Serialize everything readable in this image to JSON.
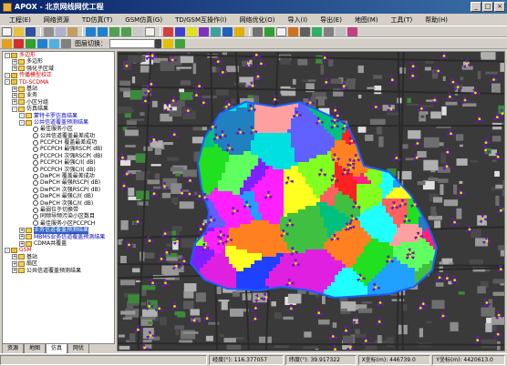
{
  "window": {
    "title": "APOX - 北京网线网优工程",
    "min": "_",
    "max": "□",
    "close": "×"
  },
  "menu": [
    "工程(E)",
    "网络资源",
    "TD仿真(T)",
    "GSM仿真(G)",
    "TD/GSM互操作(I)",
    "网络优化(O)",
    "导入(I)",
    "导出(E)",
    "地图(M)",
    "工具(T)",
    "帮助(H)"
  ],
  "toolbar2": {
    "label": "图层切换："
  },
  "tree": [
    {
      "level": 0,
      "exp": "-",
      "icon": "folder",
      "text": "多边形",
      "color": "red"
    },
    {
      "level": 1,
      "exp": "+",
      "icon": "item",
      "text": "多边形"
    },
    {
      "level": 1,
      "exp": "+",
      "icon": "item",
      "text": "强化子区域"
    },
    {
      "level": 0,
      "exp": "-",
      "icon": "folder",
      "text": "传播模型校正",
      "color": "red"
    },
    {
      "level": 0,
      "exp": "-",
      "icon": "folder",
      "text": "TD-SCDMA",
      "color": "red"
    },
    {
      "level": 1,
      "exp": "+",
      "icon": "item",
      "text": "基站"
    },
    {
      "level": 1,
      "exp": "+",
      "icon": "item",
      "text": "业务"
    },
    {
      "level": 1,
      "exp": "+",
      "icon": "item",
      "text": "小区分组"
    },
    {
      "level": 1,
      "exp": "-",
      "icon": "item",
      "text": "仿真结果"
    },
    {
      "level": 2,
      "exp": "-",
      "icon": "item",
      "text": "蒙特卡罗仿真结果",
      "color": "blue"
    },
    {
      "level": 2,
      "exp": "-",
      "icon": "item",
      "text": "公共信道覆盖预测结果",
      "color": "blue"
    },
    {
      "level": 3,
      "exp": "",
      "icon": "radio",
      "text": "最佳服务小区"
    },
    {
      "level": 3,
      "exp": "",
      "icon": "radio",
      "text": "公共信道覆盖最差成功"
    },
    {
      "level": 3,
      "exp": "",
      "icon": "radio",
      "text": "PCCPCH 覆盖最差成功"
    },
    {
      "level": 3,
      "exp": "",
      "icon": "radio",
      "text": "PCCPCH 最强RSCP( dB)"
    },
    {
      "level": 3,
      "exp": "",
      "icon": "radio",
      "text": "PCCPCH 次强RSCP( dB)"
    },
    {
      "level": 3,
      "exp": "",
      "icon": "radio",
      "text": "PCCPCH 最强C/I( dB)"
    },
    {
      "level": 3,
      "exp": "",
      "icon": "radio",
      "text": "PCCPCH 次强C/I( dB)"
    },
    {
      "level": 3,
      "exp": "",
      "icon": "radio",
      "text": "DwPCH 覆盖最差成功"
    },
    {
      "level": 3,
      "exp": "",
      "icon": "radio",
      "text": "DwPCH 最强RSCP( dB)"
    },
    {
      "level": 3,
      "exp": "",
      "icon": "radio",
      "text": "DwPCH 次强RSCP( dB)"
    },
    {
      "level": 3,
      "exp": "",
      "icon": "radio",
      "text": "DwPCH 最强C/I( dB)"
    },
    {
      "level": 3,
      "exp": "",
      "icon": "radio",
      "text": "DwPCH 次强C/I( dB)"
    },
    {
      "level": 3,
      "exp": "",
      "icon": "radio",
      "text": "最弱位于切换带"
    },
    {
      "level": 3,
      "exp": "",
      "icon": "radio",
      "text": "同频导频污染小区数目"
    },
    {
      "level": 3,
      "exp": "",
      "icon": "radio",
      "text": "最佳服务小区PCCPCH"
    },
    {
      "level": 2,
      "exp": "+",
      "icon": "item",
      "text": "业务信道覆盖预测结果",
      "color": "blue",
      "highlight": true
    },
    {
      "level": 2,
      "exp": "+",
      "icon": "item",
      "text": "MBMS业务信道覆盖预测结果",
      "color": "blue"
    },
    {
      "level": 2,
      "exp": "+",
      "icon": "item",
      "text": "CDMA共覆盖"
    },
    {
      "level": 0,
      "exp": "-",
      "icon": "folder",
      "text": "GSM",
      "color": "red"
    },
    {
      "level": 1,
      "exp": "+",
      "icon": "item",
      "text": "基站"
    },
    {
      "level": 1,
      "exp": "+",
      "icon": "item",
      "text": "扇区"
    },
    {
      "level": 1,
      "exp": "+",
      "icon": "item",
      "text": "公共信道覆盖预测结果"
    }
  ],
  "tabs": [
    "资源",
    "地图",
    "仿真",
    "网优"
  ],
  "status": {
    "lon_label": "经度(°):",
    "lon": "116.377057",
    "lat_label": "纬度(°):",
    "lat": "39.917322",
    "x_label": "X坐标(m):",
    "x": "446739.0",
    "y_label": "Y坐标(m):",
    "y": "4420613.0"
  },
  "colors": {
    "title_start": "#0a246a",
    "title_end": "#3a6ea5",
    "panel_bg": "#d4d0c8",
    "map_bg": "#3a3a3a",
    "sector_purple": "#6a1ab0",
    "site_yellow": "#e8e000",
    "polygon_border": "#1a60ff"
  }
}
